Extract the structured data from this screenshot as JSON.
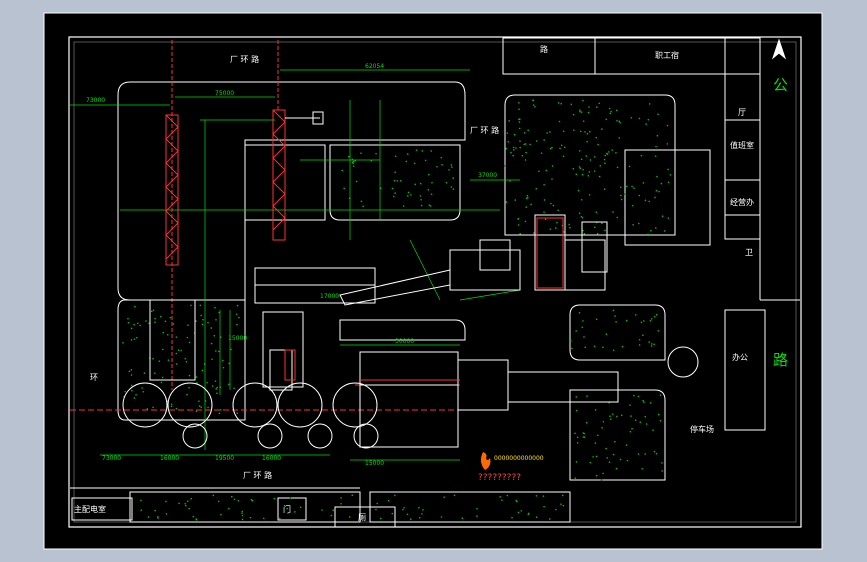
{
  "colors": {
    "background": "#000000",
    "outline": "#ffffff",
    "dimension": "#00e000",
    "crane": "#ff3030",
    "vegetation": "#00c000",
    "logo": "#ffcc00"
  },
  "labels": {
    "road_top": "厂 环 路",
    "road_left": "环",
    "road_bottom": "厂 环 路",
    "road_mid": "厂 环 路",
    "gate_top": "路",
    "staff_room": "职工宿",
    "office_1": "厅",
    "office_2": "值班室",
    "office_3": "经营办",
    "office_4": "卫",
    "public_road_1": "公",
    "public_road_2": "路",
    "office_5": "办公",
    "parking": "停车场",
    "power_room": "主配电室",
    "gate_bottom": "门",
    "bottom_room": "厕",
    "watermark_code": "0000000000000",
    "watermark_text": "?????????"
  },
  "dimensions": {
    "d1": "62054",
    "d2": "73000",
    "d3": "75000",
    "d4": "37000",
    "d5": "73000",
    "d6": "16000",
    "d7": "19500",
    "d8": "16000",
    "d9": "15000",
    "d10": "30000",
    "d11": "17000",
    "d12": "15000"
  }
}
